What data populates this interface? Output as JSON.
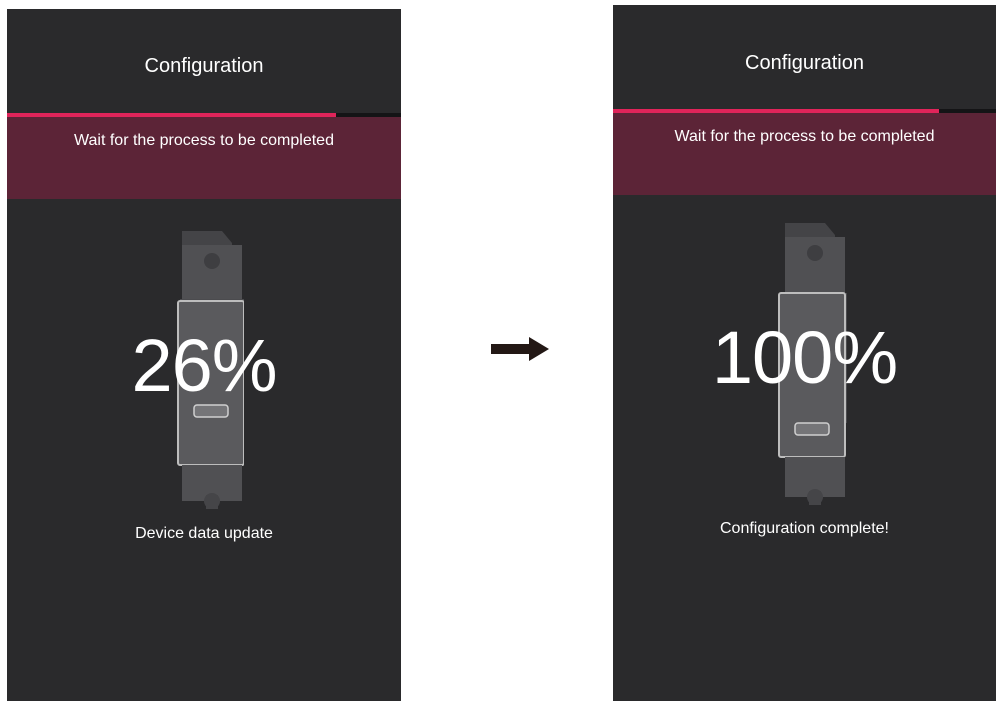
{
  "screens": {
    "left": {
      "title": "Configuration",
      "progress_fraction": 0.835,
      "banner_text": "Wait for the process to be completed",
      "percent_text": "26%",
      "status_text": "Device data update"
    },
    "right": {
      "title": "Configuration",
      "progress_fraction": 0.85,
      "banner_text": "Wait for the process to be completed",
      "percent_text": "100%",
      "status_text": "Configuration complete!"
    }
  },
  "icons": {
    "device": "device-module-icon",
    "arrow": "arrow-right-icon"
  },
  "colors": {
    "screen_bg": "#2a2a2c",
    "banner_bg": "#5c2437",
    "progress_fill": "#e0245a",
    "progress_track": "#141416",
    "text": "#ffffff"
  }
}
